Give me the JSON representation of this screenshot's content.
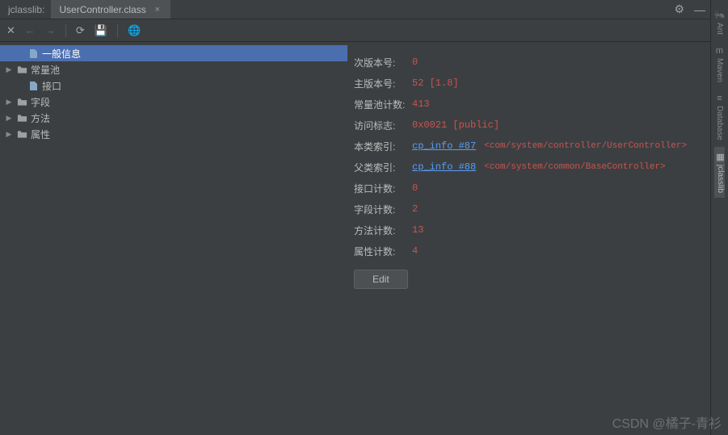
{
  "tabBar": {
    "leftLabel": "jclasslib:",
    "tabName": "UserController.class"
  },
  "tree": {
    "items": [
      {
        "label": "一般信息",
        "type": "file",
        "indent": 1,
        "selected": true,
        "expandable": false
      },
      {
        "label": "常量池",
        "type": "folder",
        "indent": 0,
        "selected": false,
        "expandable": true
      },
      {
        "label": "接口",
        "type": "file",
        "indent": 1,
        "selected": false,
        "expandable": false
      },
      {
        "label": "字段",
        "type": "folder",
        "indent": 0,
        "selected": false,
        "expandable": true
      },
      {
        "label": "方法",
        "type": "folder",
        "indent": 0,
        "selected": false,
        "expandable": true
      },
      {
        "label": "属性",
        "type": "folder",
        "indent": 0,
        "selected": false,
        "expandable": true
      }
    ]
  },
  "detail": {
    "minorVersion": {
      "label": "次版本号:",
      "value": "0"
    },
    "majorVersion": {
      "label": "主版本号:",
      "value": "52 [1.8]"
    },
    "constantPoolCount": {
      "label": "常量池计数:",
      "value": "413"
    },
    "accessFlags": {
      "label": "访问标志:",
      "value": "0x0021 [public]"
    },
    "thisClass": {
      "label": "本类索引:",
      "link": "cp_info #87",
      "comment": "<com/system/controller/UserController>"
    },
    "superClass": {
      "label": "父类索引:",
      "link": "cp_info #88",
      "comment": "<com/system/common/BaseController>"
    },
    "interfaceCount": {
      "label": "接口计数:",
      "value": "0"
    },
    "fieldCount": {
      "label": "字段计数:",
      "value": "2"
    },
    "methodCount": {
      "label": "方法计数:",
      "value": "13"
    },
    "attributeCount": {
      "label": "属性计数:",
      "value": "4"
    },
    "editButton": "Edit"
  },
  "rightRail": {
    "items": [
      {
        "label": "Ant",
        "icon": "🐜",
        "active": false
      },
      {
        "label": "Maven",
        "icon": "m",
        "active": false
      },
      {
        "label": "Database",
        "icon": "≡",
        "active": false
      },
      {
        "label": "jclasslib",
        "icon": "▦",
        "active": true
      }
    ]
  },
  "watermark": "CSDN @橘子-青衫"
}
